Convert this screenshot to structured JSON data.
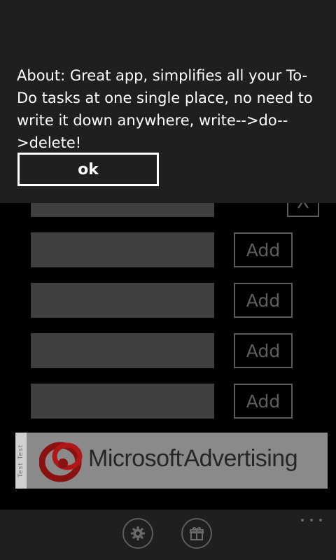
{
  "dialog": {
    "message": "About: Great app, simplifies all your To-Do tasks at one single place, no need to write it down anywhere, write-->do-->delete!",
    "ok_label": "ok"
  },
  "tasks": {
    "remove_label": "X",
    "rows": [
      {
        "value": "",
        "add_label": "Add"
      },
      {
        "value": "",
        "add_label": "Add"
      },
      {
        "value": "",
        "add_label": "Add"
      },
      {
        "value": "",
        "add_label": "Add"
      }
    ]
  },
  "ad": {
    "test_label": "Test Test",
    "brand": "Microsoft",
    "brand_suffix": "Advertising"
  },
  "appbar": {
    "buttons": [
      {
        "icon": "gear-icon"
      },
      {
        "icon": "gift-icon"
      }
    ],
    "more_icon": "more-dots-icon"
  }
}
